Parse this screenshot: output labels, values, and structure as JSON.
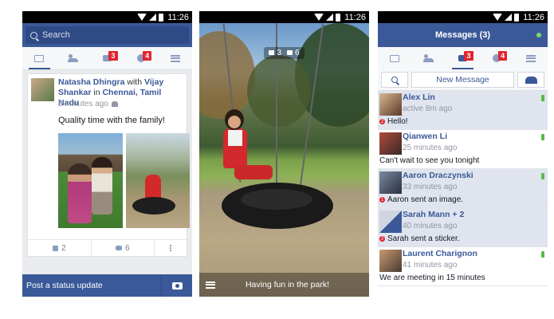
{
  "status_time": "11:26",
  "colors": {
    "brand": "#3b5998",
    "badge": "#e0262e",
    "online": "#5db84a"
  },
  "feed": {
    "search_placeholder": "Search",
    "tabs": [
      {
        "icon": "news-feed-icon"
      },
      {
        "icon": "friends-icon"
      },
      {
        "icon": "messages-icon",
        "badge": "3"
      },
      {
        "icon": "notifications-globe-icon",
        "badge": "4"
      },
      {
        "icon": "menu-icon"
      }
    ],
    "post": {
      "author": "Natasha Dhingra",
      "with_word": " with ",
      "tagged": "Vijay Shankar",
      "in_word": " in ",
      "location": "Chennai, Tamil Nadu",
      "time": "5 minutes ago",
      "text": "Quality time with the family!",
      "likes": "2",
      "comments": "6"
    },
    "composer_label": "Post a status update"
  },
  "photo_view": {
    "comments": "3",
    "likes": "6",
    "caption": "Having fun in the park!"
  },
  "messages": {
    "title": "Messages (3)",
    "new_message_label": "New Message",
    "threads": [
      {
        "name": "Alex Lin",
        "time": "active 8m ago",
        "preview": "Hello!",
        "unread_count": "2",
        "unread": true,
        "mobile": true
      },
      {
        "name": "Qianwen  Li",
        "time": "25 minutes ago",
        "preview": "Can't wait to see you tonight",
        "unread_count": "",
        "unread": false,
        "mobile": true
      },
      {
        "name": "Aaron Draczynski",
        "time": "33 minutes ago",
        "preview": "Aaron sent an image.",
        "unread_count": "1",
        "unread": true,
        "mobile": true
      },
      {
        "name": "Sarah Mann + 2",
        "time": "40 minutes ago",
        "preview": "Sarah sent a sticker.",
        "unread_count": "2",
        "unread": true,
        "mobile": false
      },
      {
        "name": "Laurent Charignon",
        "time": "41 minutes ago",
        "preview": "We are meeting in 15 minutes",
        "unread_count": "",
        "unread": false,
        "mobile": true
      }
    ]
  }
}
